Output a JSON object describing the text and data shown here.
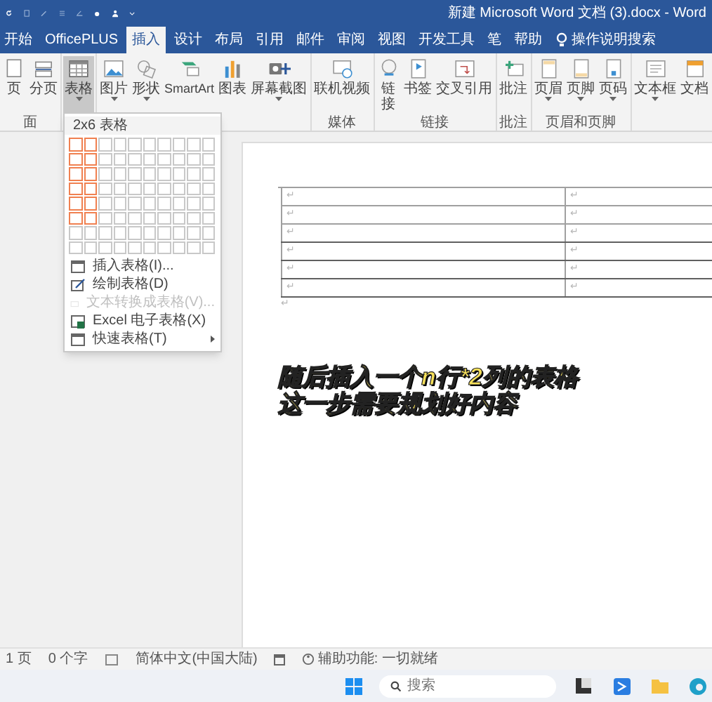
{
  "window": {
    "title": "新建 Microsoft Word 文档 (3).docx  -  Word"
  },
  "tabs": [
    {
      "label": "开始",
      "selected": false
    },
    {
      "label": "OfficePLUS",
      "selected": false
    },
    {
      "label": "插入",
      "selected": true
    },
    {
      "label": "设计",
      "selected": false
    },
    {
      "label": "布局",
      "selected": false
    },
    {
      "label": "引用",
      "selected": false
    },
    {
      "label": "邮件",
      "selected": false
    },
    {
      "label": "审阅",
      "selected": false
    },
    {
      "label": "视图",
      "selected": false
    },
    {
      "label": "开发工具",
      "selected": false
    },
    {
      "label": "笔",
      "selected": false
    },
    {
      "label": "帮助",
      "selected": false
    }
  ],
  "tell_me": {
    "label": "操作说明搜索"
  },
  "ribbon_groups": [
    {
      "label": "面",
      "buttons": [
        {
          "label": "页",
          "kind": "page",
          "pressed": false,
          "dropdown": false
        },
        {
          "label": "分页",
          "kind": "break",
          "pressed": false,
          "dropdown": false
        }
      ]
    },
    {
      "buttons": [
        {
          "label": "表格",
          "kind": "table",
          "pressed": true,
          "dropdown": true
        }
      ]
    },
    {
      "buttons": [
        {
          "label": "图片",
          "kind": "picture",
          "pressed": false,
          "dropdown": true
        },
        {
          "label": "形状",
          "kind": "shapes",
          "pressed": false,
          "dropdown": true
        },
        {
          "label": "SmartArt",
          "kind": "smartart",
          "pressed": false,
          "dropdown": false
        },
        {
          "label": "图表",
          "kind": "chart",
          "pressed": false,
          "dropdown": false
        },
        {
          "label": "屏幕截图",
          "kind": "screenshot",
          "pressed": false,
          "dropdown": true
        }
      ]
    },
    {
      "label": "媒体",
      "buttons": [
        {
          "label": "联机视频",
          "kind": "video",
          "pressed": false,
          "dropdown": false
        }
      ]
    },
    {
      "label": "链接",
      "buttons": [
        {
          "label": "链接",
          "kind": "link",
          "pressed": false,
          "dropdown": false
        },
        {
          "label": "书签",
          "kind": "bookmark",
          "pressed": false,
          "dropdown": false
        },
        {
          "label": "交叉引用",
          "kind": "crossref",
          "pressed": false,
          "dropdown": false
        }
      ]
    },
    {
      "label": "批注",
      "buttons": [
        {
          "label": "批注",
          "kind": "comment",
          "pressed": false,
          "dropdown": false
        }
      ]
    },
    {
      "label": "页眉和页脚",
      "buttons": [
        {
          "label": "页眉",
          "kind": "header",
          "pressed": false,
          "dropdown": true
        },
        {
          "label": "页脚",
          "kind": "footer",
          "pressed": false,
          "dropdown": true
        },
        {
          "label": "页码",
          "kind": "pagenum",
          "pressed": false,
          "dropdown": true
        }
      ]
    },
    {
      "buttons": [
        {
          "label": "文本框",
          "kind": "textbox",
          "pressed": false,
          "dropdown": true
        },
        {
          "label": "文档",
          "kind": "docpart",
          "pressed": false,
          "dropdown": false
        }
      ]
    }
  ],
  "table_menu": {
    "title": "2x6 表格",
    "grid": [
      {
        "cells": [
          {
            "selected": true
          },
          {
            "selected": true
          },
          {
            "selected": false
          },
          {
            "selected": false
          },
          {
            "selected": false
          },
          {
            "selected": false
          },
          {
            "selected": false
          },
          {
            "selected": false
          },
          {
            "selected": false
          },
          {
            "selected": false
          }
        ]
      },
      {
        "cells": [
          {
            "selected": true
          },
          {
            "selected": true
          },
          {
            "selected": false
          },
          {
            "selected": false
          },
          {
            "selected": false
          },
          {
            "selected": false
          },
          {
            "selected": false
          },
          {
            "selected": false
          },
          {
            "selected": false
          },
          {
            "selected": false
          }
        ]
      },
      {
        "cells": [
          {
            "selected": true
          },
          {
            "selected": true
          },
          {
            "selected": false
          },
          {
            "selected": false
          },
          {
            "selected": false
          },
          {
            "selected": false
          },
          {
            "selected": false
          },
          {
            "selected": false
          },
          {
            "selected": false
          },
          {
            "selected": false
          }
        ]
      },
      {
        "cells": [
          {
            "selected": true
          },
          {
            "selected": true
          },
          {
            "selected": false
          },
          {
            "selected": false
          },
          {
            "selected": false
          },
          {
            "selected": false
          },
          {
            "selected": false
          },
          {
            "selected": false
          },
          {
            "selected": false
          },
          {
            "selected": false
          }
        ]
      },
      {
        "cells": [
          {
            "selected": true
          },
          {
            "selected": true
          },
          {
            "selected": false
          },
          {
            "selected": false
          },
          {
            "selected": false
          },
          {
            "selected": false
          },
          {
            "selected": false
          },
          {
            "selected": false
          },
          {
            "selected": false
          },
          {
            "selected": false
          }
        ]
      },
      {
        "cells": [
          {
            "selected": true
          },
          {
            "selected": true
          },
          {
            "selected": false
          },
          {
            "selected": false
          },
          {
            "selected": false
          },
          {
            "selected": false
          },
          {
            "selected": false
          },
          {
            "selected": false
          },
          {
            "selected": false
          },
          {
            "selected": false
          }
        ]
      },
      {
        "cells": [
          {
            "selected": false
          },
          {
            "selected": false
          },
          {
            "selected": false
          },
          {
            "selected": false
          },
          {
            "selected": false
          },
          {
            "selected": false
          },
          {
            "selected": false
          },
          {
            "selected": false
          },
          {
            "selected": false
          },
          {
            "selected": false
          }
        ]
      },
      {
        "cells": [
          {
            "selected": false
          },
          {
            "selected": false
          },
          {
            "selected": false
          },
          {
            "selected": false
          },
          {
            "selected": false
          },
          {
            "selected": false
          },
          {
            "selected": false
          },
          {
            "selected": false
          },
          {
            "selected": false
          },
          {
            "selected": false
          }
        ]
      }
    ],
    "items": [
      {
        "label": "插入表格(I)...",
        "kind": "insert",
        "disabled": false,
        "submenu": false
      },
      {
        "label": "绘制表格(D)",
        "kind": "draw",
        "disabled": false,
        "submenu": false
      },
      {
        "label": "文本转换成表格(V)...",
        "kind": "convert",
        "disabled": true,
        "submenu": false
      },
      {
        "label": "Excel 电子表格(X)",
        "kind": "excel",
        "disabled": false,
        "submenu": false
      },
      {
        "label": "快速表格(T)",
        "kind": "quick",
        "disabled": false,
        "submenu": true
      }
    ]
  },
  "document": {
    "table": [
      [
        "↵",
        "↵"
      ],
      [
        "↵",
        "↵"
      ],
      [
        "↵",
        "↵"
      ],
      [
        "↵",
        "↵"
      ],
      [
        "↵",
        "↵"
      ],
      [
        "↵",
        "↵"
      ]
    ],
    "after_mark": "↵"
  },
  "caption": [
    "随后插入一个n行*2列的表格",
    "这一步需要规划好内容"
  ],
  "status_bar": {
    "page": "1 页",
    "words": "0 个字",
    "language": "简体中文(中国大陆)",
    "accessibility": "辅助功能: 一切就绪"
  },
  "taskbar": {
    "search_placeholder": "搜索"
  }
}
